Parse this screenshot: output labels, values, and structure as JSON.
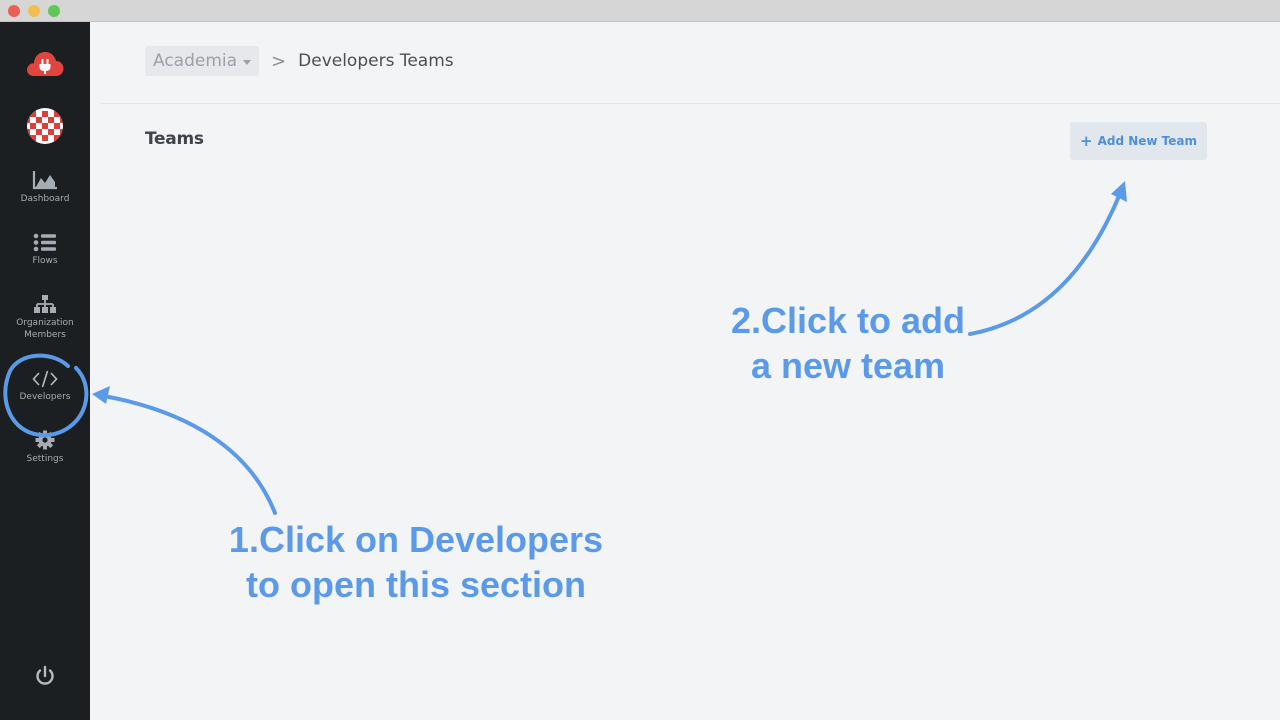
{
  "window": {
    "controls": [
      "close",
      "minimize",
      "zoom"
    ]
  },
  "sidebar": {
    "logo_icon": "cloud-plug-icon",
    "avatar_icon": "identicon-avatar",
    "items": [
      {
        "label": "Dashboard",
        "icon": "area-chart-icon"
      },
      {
        "label": "Flows",
        "icon": "list-icon"
      },
      {
        "label_line1": "Organization",
        "label_line2": "Members",
        "icon": "org-chart-icon"
      },
      {
        "label": "Developers",
        "icon": "code-icon"
      },
      {
        "label": "Settings",
        "icon": "gear-icon"
      }
    ],
    "power_icon": "power-icon"
  },
  "breadcrumb": {
    "org": "Academia",
    "separator": ">",
    "current": "Developers Teams"
  },
  "teams": {
    "title": "Teams",
    "add_button": {
      "plus": "+",
      "label": "Add New Team"
    }
  },
  "annotations": {
    "step2_line1": "2.Click to add",
    "step2_line2": "a new team",
    "step1_line1": "1.Click on Developers",
    "step1_line2": "to open this section"
  },
  "colors": {
    "sidebar_bg": "#1c1f22",
    "page_bg": "#f3f4f6",
    "accent_blue": "#5b9ae8",
    "logo_red": "#e0463d"
  }
}
